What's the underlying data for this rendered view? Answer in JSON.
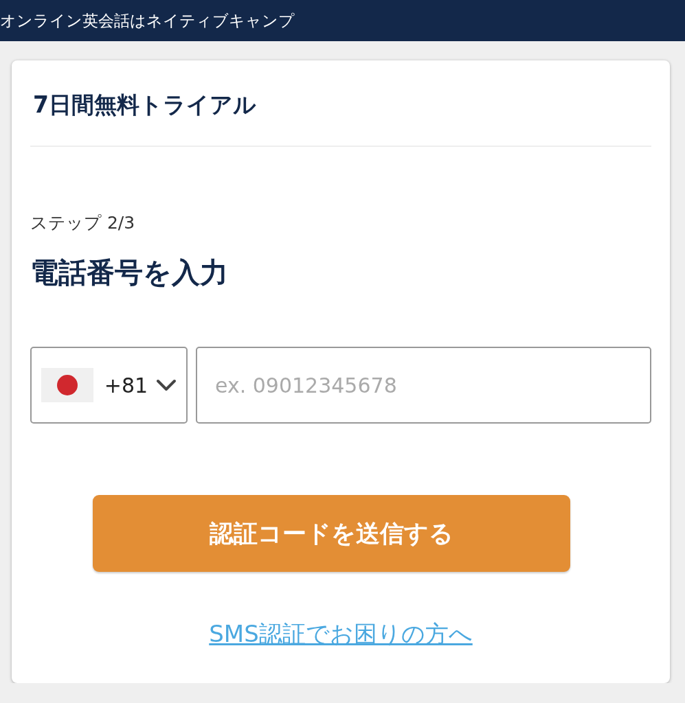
{
  "header": {
    "title": "オンライン英会話はネイティブキャンプ"
  },
  "card": {
    "title": "7日間無料トライアル",
    "step": "ステップ 2/3",
    "heading": "電話番号を入力",
    "phone": {
      "country_code": "+81",
      "placeholder": "ex. 09012345678"
    },
    "submit_button": "認証コードを送信する",
    "help_link": "SMS認証でお困りの方へ"
  }
}
